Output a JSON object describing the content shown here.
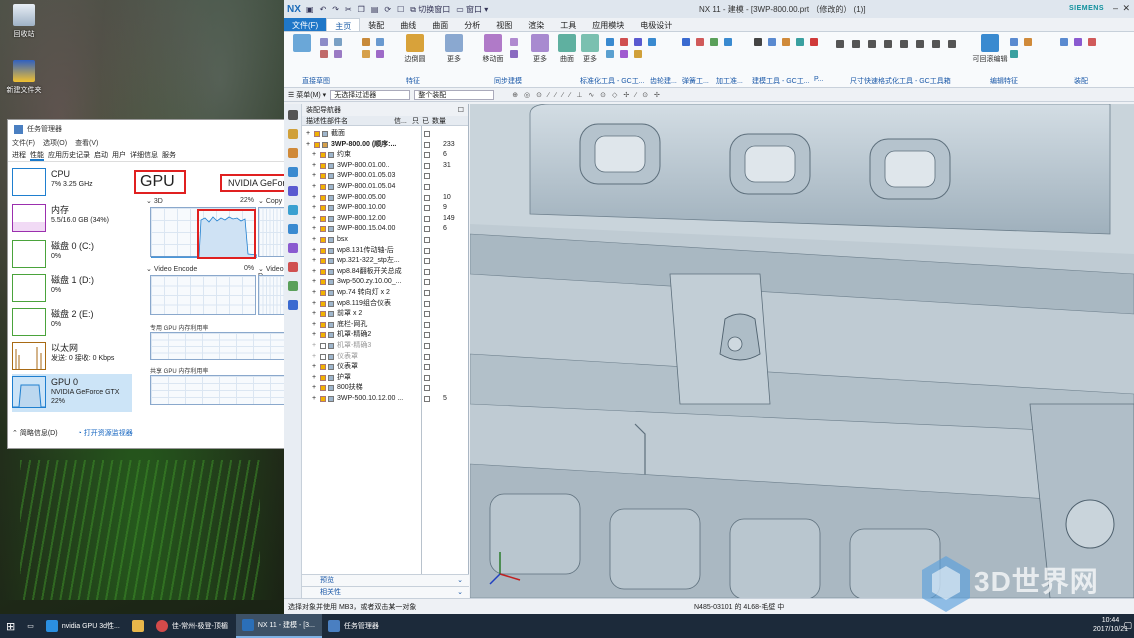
{
  "desktop": {
    "icons": [
      {
        "name": "recycle-bin",
        "label": "回收站"
      },
      {
        "name": "new-folder",
        "label": "新建文件夹"
      }
    ]
  },
  "task_manager": {
    "title": "任务管理器",
    "menu": [
      "文件(F)",
      "选项(O)",
      "查看(V)"
    ],
    "tabs": [
      "进程",
      "性能",
      "应用历史记录",
      "启动",
      "用户",
      "详细信息",
      "服务"
    ],
    "active_tab": "性能",
    "side_items": [
      {
        "title": "CPU",
        "sub": "7% 3.25 GHz",
        "color": "#1f7fcf"
      },
      {
        "title": "内存",
        "sub": "5.5/16.0 GB (34%)",
        "color": "#9b2fae"
      },
      {
        "title": "磁盘 0 (C:)",
        "sub": "0%",
        "color": "#4aa33b"
      },
      {
        "title": "磁盘 1 (D:)",
        "sub": "0%",
        "color": "#4aa33b"
      },
      {
        "title": "磁盘 2 (E:)",
        "sub": "0%",
        "color": "#4aa33b"
      },
      {
        "title": "以太网",
        "sub": "发送: 0 接收: 0 Kbps",
        "color": "#a86a14"
      },
      {
        "title": "GPU 0",
        "sub": "NVIDIA GeForce GTX",
        "sub2": "22%",
        "color": "#1f7fcf"
      }
    ],
    "gpu_heading": "GPU",
    "gpu_name": "NVIDIA GeForce",
    "graphs": {
      "3d_label": "3D",
      "3d_pct": "22%",
      "copy_label": "Copy",
      "encode_label": "Video Encode",
      "encode_pct": "0%",
      "decode_label": "Video D",
      "dedicated_label": "专用 GPU 内存利用率",
      "shared_label": "共享 GPU 内存利用率"
    },
    "footer_less": "简略信息(D)",
    "footer_link": "打开资源监视器"
  },
  "nx": {
    "logo": "NX",
    "quick_access": [
      "切换窗口",
      "窗口"
    ],
    "title": "NX 11 - 建模 - [3WP-800.00.prt （修改的） (1)]",
    "brand": "SIEMENS",
    "tabs": [
      "文件(F)",
      "主页",
      "装配",
      "曲线",
      "曲面",
      "分析",
      "视图",
      "渲染",
      "工具",
      "应用模块",
      "电极设计"
    ],
    "active_tab": "主页",
    "ribbon_groups": [
      "直接草图",
      "特征",
      "同步建模",
      "标准化工具 - GC工...",
      "齿轮建...",
      "弹簧工...",
      "加工准...",
      "建模工具 - GC工...",
      "P...",
      "尺寸快速格式化工具 - GC工具箱",
      "编辑特征",
      "装配"
    ],
    "ribbon_buttons": [
      "边倒圆",
      "更多",
      "移动面",
      "更多",
      "曲面",
      "更多",
      "可回滚编辑"
    ],
    "filter_menu": "菜单(M)",
    "filter_select": "无选择过滤器",
    "filter_scope": "整个装配",
    "nav": {
      "title": "装配导航器",
      "columns": [
        "描述性部件名",
        "信...",
        "只",
        "已",
        "数量"
      ],
      "rows": [
        {
          "name": "截面",
          "indent": 1,
          "num": ""
        },
        {
          "name": "3WP-800.00 (顺序:...",
          "indent": 1,
          "num": "233",
          "bold": true
        },
        {
          "name": "约束",
          "indent": 2,
          "num": "6"
        },
        {
          "name": "3WP-800.01.00..",
          "indent": 2,
          "num": "31"
        },
        {
          "name": "3WP-800.01.05.03",
          "indent": 2,
          "num": ""
        },
        {
          "name": "3WP-800.01.05.04",
          "indent": 2,
          "num": ""
        },
        {
          "name": "3WP-800.05.00",
          "indent": 2,
          "num": "10"
        },
        {
          "name": "3WP-800.10.00",
          "indent": 2,
          "num": "9"
        },
        {
          "name": "3WP-800.12.00",
          "indent": 2,
          "num": "149"
        },
        {
          "name": "3WP-800.15.04.00",
          "indent": 2,
          "num": "6"
        },
        {
          "name": "bsx",
          "indent": 2,
          "num": ""
        },
        {
          "name": "wp8.131传动轴-后",
          "indent": 2,
          "num": ""
        },
        {
          "name": "wp.321-322_stp左...",
          "indent": 2,
          "num": ""
        },
        {
          "name": "wp8.84翻板开关总成",
          "indent": 2,
          "num": ""
        },
        {
          "name": "3wp-500.zy.10.00_...",
          "indent": 2,
          "num": ""
        },
        {
          "name": "wp.74 转向灯 x 2",
          "indent": 2,
          "num": ""
        },
        {
          "name": "wp8.119组合仪表",
          "indent": 2,
          "num": ""
        },
        {
          "name": "前罩 x 2",
          "indent": 2,
          "num": ""
        },
        {
          "name": "底栏-网孔",
          "indent": 2,
          "num": ""
        },
        {
          "name": "机罩-精确2",
          "indent": 2,
          "num": ""
        },
        {
          "name": "机罩-精确3",
          "indent": 2,
          "num": "",
          "gray": true
        },
        {
          "name": "仪表罩",
          "indent": 2,
          "num": "",
          "gray": true
        },
        {
          "name": "仪表罩",
          "indent": 2,
          "num": ""
        },
        {
          "name": "护罩",
          "indent": 2,
          "num": ""
        },
        {
          "name": "800扶梯",
          "indent": 2,
          "num": ""
        },
        {
          "name": "3WP-500.10.12.00 ...",
          "indent": 2,
          "num": "5"
        }
      ],
      "footer_preview": "预览",
      "footer_related": "相关性"
    },
    "status_left": "选择对象并使用 MB3，或者双击某一对象",
    "status_mid": "N485-03101 的 4L68-毛壁 中"
  },
  "watermark": "3D世界网",
  "taskbar": {
    "items": [
      {
        "label": "nvidia GPU 3d性...",
        "color": "#2b8fe0"
      },
      {
        "label": "",
        "color": "#e8b64a"
      },
      {
        "label": "佳-常州-极登-顶楣",
        "color": "#d44a4a"
      },
      {
        "label": "NX 11 - 建模 - [3...",
        "color": "#2b6fb8",
        "active": true
      },
      {
        "label": "任务管理器",
        "color": "#4a7fc1"
      }
    ],
    "time": "10:44",
    "date": "2017/10/21"
  },
  "colors": {
    "accent": "#1f77c8",
    "siemens": "#0d8f9c",
    "highlight": "#e02020"
  }
}
